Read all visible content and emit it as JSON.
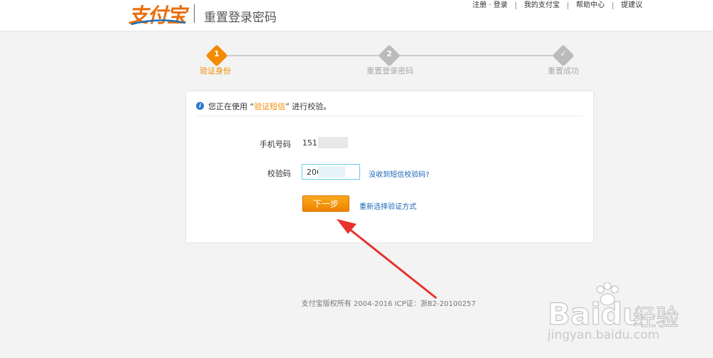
{
  "header": {
    "logo_text": "支付宝",
    "title": "重置登录密码",
    "links": [
      "注册 · 登录",
      "我的支付宝",
      "帮助中心",
      "提建议"
    ]
  },
  "steps": [
    {
      "num": "1",
      "label": "验证身份",
      "active": true
    },
    {
      "num": "2",
      "label": "重置登录密码",
      "active": false
    },
    {
      "num": "✓",
      "label": "重置成功",
      "active": false
    }
  ],
  "notice": {
    "prefix": "您正在使用 “",
    "highlight": "验证短信",
    "suffix": "” 进行校验。"
  },
  "form": {
    "phone_label": "手机号码",
    "phone_value": "151",
    "code_label": "校验码",
    "code_value": "206",
    "no_sms_link": "没收到短信校验码?",
    "next_button": "下一步",
    "reselect_link": "重新选择验证方式"
  },
  "footer": {
    "copyright": "支付宝版权所有 2004-2016 ICP证：浙B2-20100257"
  },
  "watermark": {
    "brand": "Bai",
    "brand2": "du",
    "cn": "经验",
    "url": "jingyan.baidu.com"
  },
  "colors": {
    "accent": "#f28b00",
    "link": "#1a64b8",
    "info": "#2a78c9"
  }
}
